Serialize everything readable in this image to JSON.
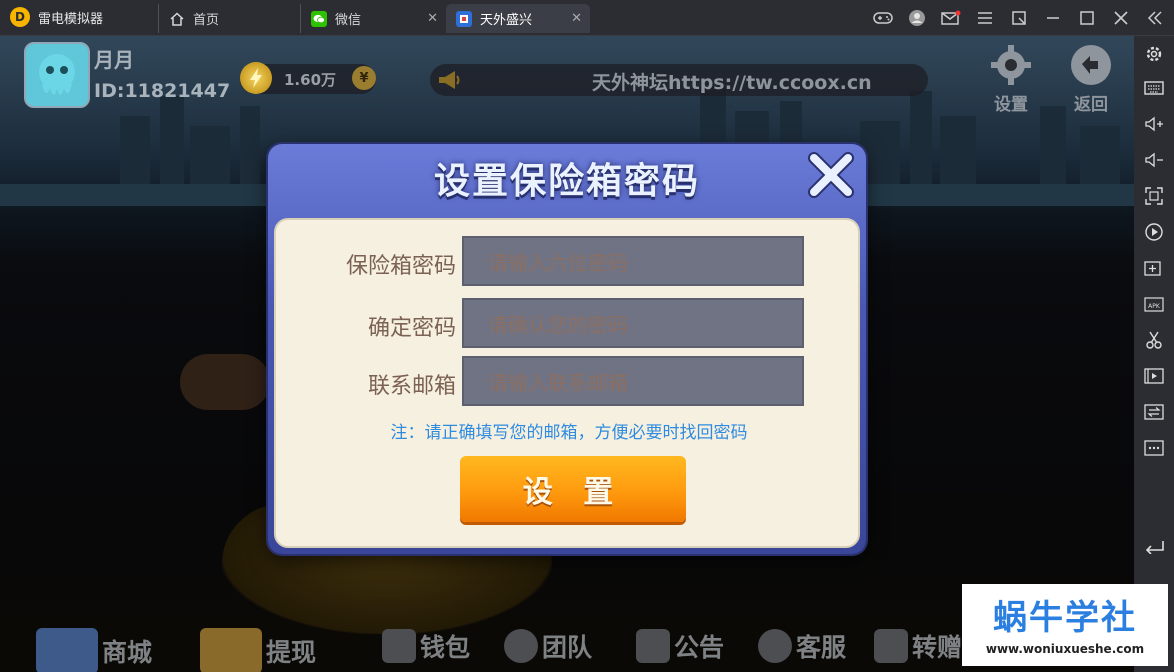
{
  "titlebar": {
    "app_name": "雷电模拟器",
    "tabs": [
      {
        "label": "首页",
        "icon": "home-icon"
      },
      {
        "label": "微信",
        "icon": "wechat-icon"
      },
      {
        "label": "天外盛兴",
        "icon": "game-icon",
        "active": true
      }
    ],
    "window_controls": [
      "gamepad-icon",
      "user-icon",
      "mail-icon",
      "menu-icon",
      "window-mode-icon",
      "minimize-icon",
      "maximize-icon",
      "close-icon",
      "collapse-icon"
    ]
  },
  "sidebar": {
    "items": [
      "settings-icon",
      "keyboard-icon",
      "volume-up-icon",
      "volume-down-icon",
      "fullscreen-icon",
      "record-icon",
      "add-window-icon",
      "apk-install-icon",
      "scissors-icon",
      "video-icon",
      "sync-icon",
      "more-icon",
      "back-icon"
    ]
  },
  "player": {
    "nickname": "月月",
    "id": "ID:11821447",
    "coins": "1.60万",
    "coin_symbol": "¥"
  },
  "marquee": {
    "text": "天外神坛https://tw.ccoox.cn"
  },
  "top_buttons": {
    "settings": "设置",
    "back": "返回"
  },
  "bottom_menu": [
    "商城",
    "提现",
    "钱包",
    "团队",
    "公告",
    "客服",
    "转赠"
  ],
  "dialog": {
    "title": "设置保险箱密码",
    "fields": [
      {
        "label": "保险箱密码",
        "placeholder": "请输入六位密码"
      },
      {
        "label": "确定密码",
        "placeholder": "请确认您的密码"
      },
      {
        "label": "联系邮箱",
        "placeholder": "请输入联系邮箱"
      }
    ],
    "note": "注：请正确填写您的邮箱，方便必要时找回密码",
    "submit": "设 置"
  },
  "watermark": {
    "title": "蜗牛学社",
    "url": "www.woniuxueshe.com"
  },
  "colors": {
    "accent_orange": "#ff9a0e",
    "dialog_blue": "#4a58b4",
    "note_blue": "#2f8be0"
  }
}
